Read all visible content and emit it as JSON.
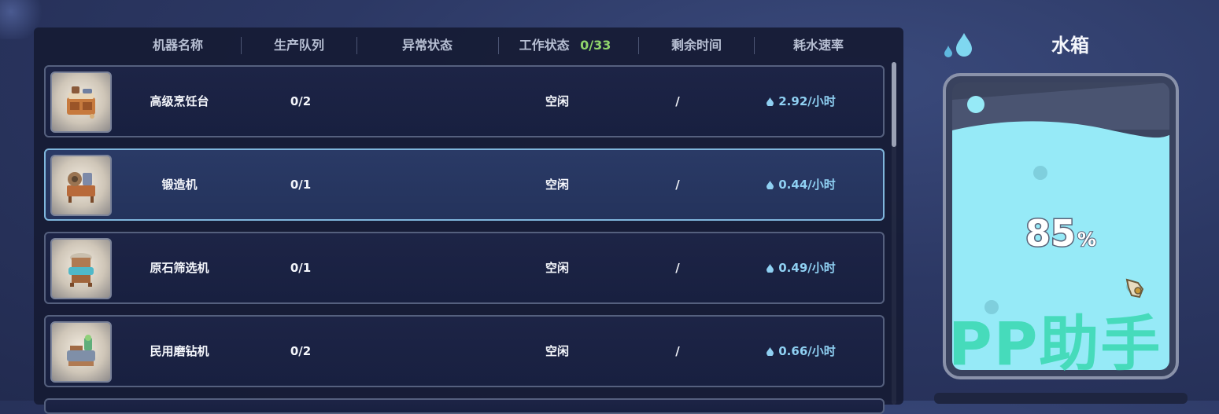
{
  "header": {
    "col_name": "机器名称",
    "col_queue": "生产队列",
    "col_abnormal": "异常状态",
    "col_work": "工作状态",
    "work_count": "0/33",
    "col_remaining": "剩余时间",
    "col_rate": "耗水速率"
  },
  "machines": [
    {
      "name": "高级烹饪台",
      "queue": "0/2",
      "abnormal": "",
      "status": "空闲",
      "remaining": "/",
      "rate": "2.92/小时",
      "icon": "cooking-station-icon"
    },
    {
      "name": "锻造机",
      "queue": "0/1",
      "abnormal": "",
      "status": "空闲",
      "remaining": "/",
      "rate": "0.44/小时",
      "icon": "forging-machine-icon"
    },
    {
      "name": "原石筛选机",
      "queue": "0/1",
      "abnormal": "",
      "status": "空闲",
      "remaining": "/",
      "rate": "0.49/小时",
      "icon": "ore-sieve-icon"
    },
    {
      "name": "民用磨钻机",
      "queue": "0/2",
      "abnormal": "",
      "status": "空闲",
      "remaining": "/",
      "rate": "0.66/小时",
      "icon": "drill-grinder-icon"
    }
  ],
  "selected_row": 1,
  "tank": {
    "title": "水箱",
    "percent_value": "85",
    "percent_symbol": "%",
    "fill_level": 0.85
  },
  "watermark": "PP助手",
  "colors": {
    "water": "#96eaf7",
    "selected_border": "#7fb6dc",
    "count_ok": "#8fd46b",
    "rate_text": "#8fd0f2",
    "watermark": "#30d6aa"
  }
}
